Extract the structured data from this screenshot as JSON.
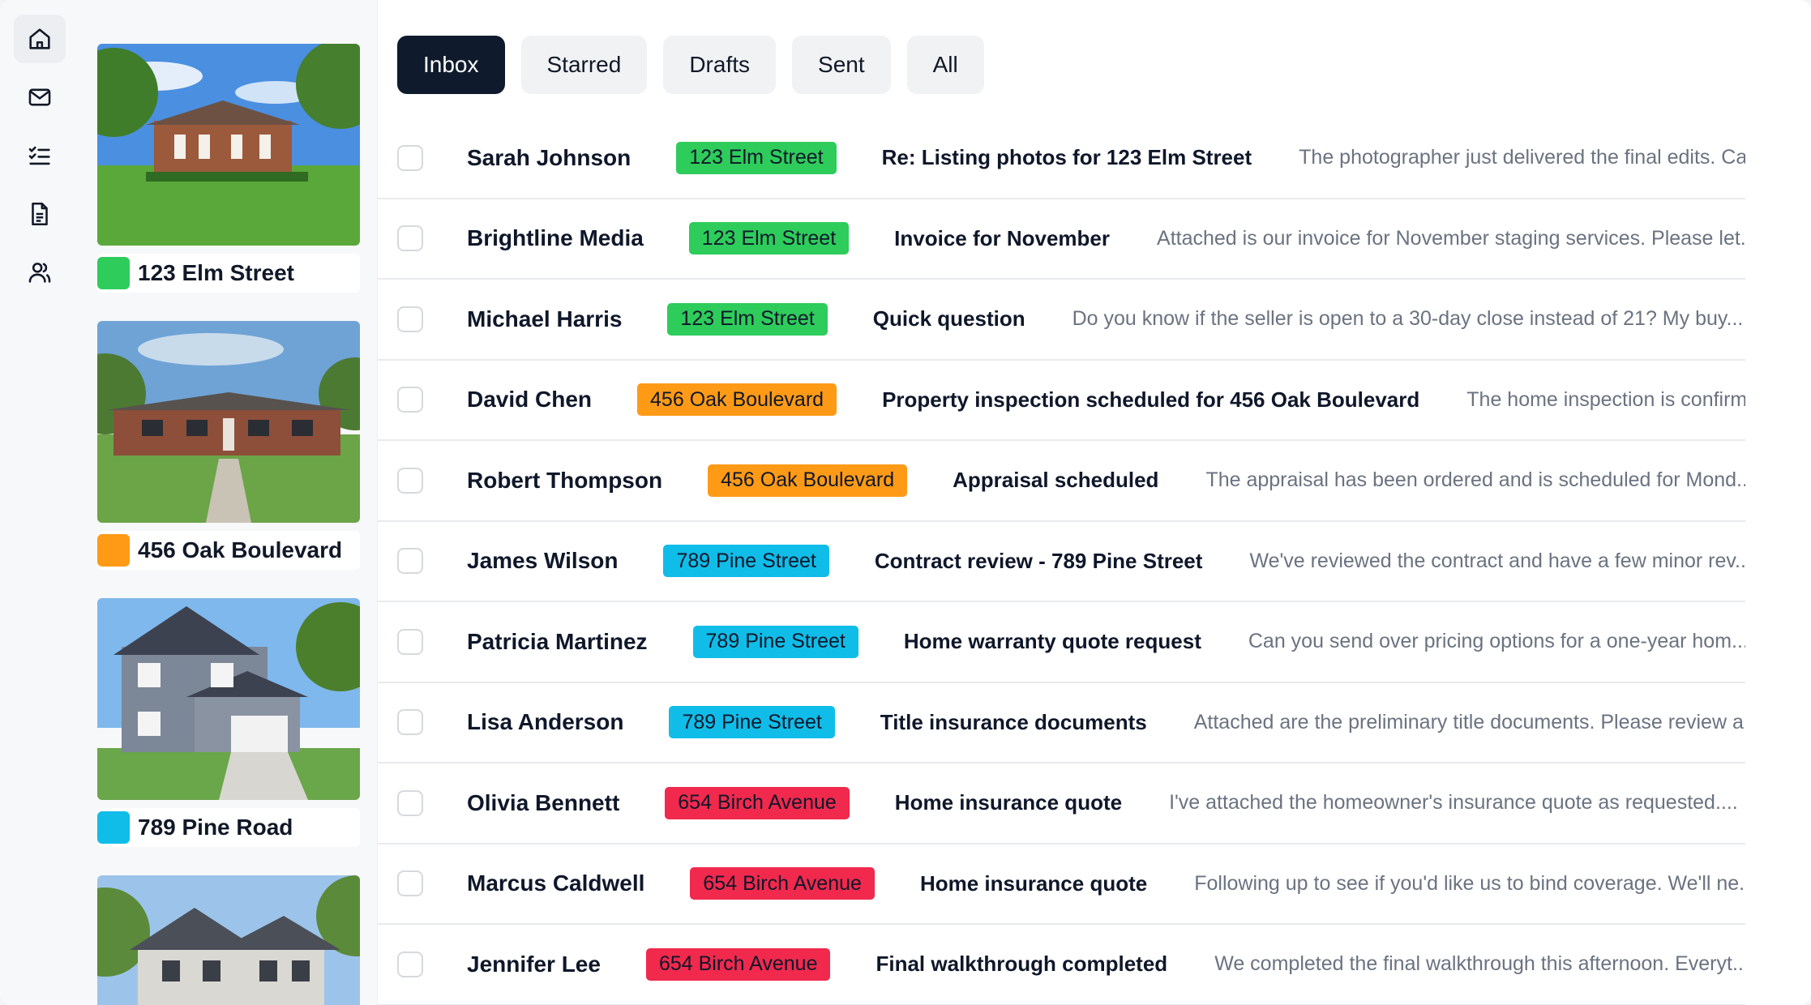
{
  "nav": {
    "icons": [
      "home-icon",
      "mail-icon",
      "checklist-icon",
      "document-icon",
      "users-icon"
    ],
    "active": "home-icon"
  },
  "properties": [
    {
      "name": "123 Elm Street",
      "color": "#2ecc5b"
    },
    {
      "name": "456 Oak Boulevard",
      "color": "#ff9a17"
    },
    {
      "name": "789 Pine Road",
      "color": "#10bde8"
    },
    {
      "name": "",
      "color": "#e8334f"
    }
  ],
  "tabs": [
    {
      "label": "Inbox",
      "active": true
    },
    {
      "label": "Starred",
      "active": false
    },
    {
      "label": "Drafts",
      "active": false
    },
    {
      "label": "Sent",
      "active": false
    },
    {
      "label": "All",
      "active": false
    }
  ],
  "messages": [
    {
      "sender": "Sarah Johnson",
      "tag": "123 Elm Street",
      "tag_color": "#2ecc5b",
      "subject": "Re: Listing photos for 123 Elm Street",
      "preview": "The photographer just delivered the final edits. Can..."
    },
    {
      "sender": "Brightline Media",
      "tag": "123 Elm Street",
      "tag_color": "#2ecc5b",
      "subject": "Invoice for November",
      "preview": "Attached is our invoice for November staging services. Please let..."
    },
    {
      "sender": "Michael Harris",
      "tag": "123 Elm Street",
      "tag_color": "#2ecc5b",
      "subject": "Quick question",
      "preview": "Do you know if the seller is open to a 30-day close instead of 21? My buy..."
    },
    {
      "sender": "David Chen",
      "tag": "456 Oak Boulevard",
      "tag_color": "#ff9a17",
      "subject": "Property inspection scheduled for 456 Oak Boulevard",
      "preview": "The home inspection is confirm..."
    },
    {
      "sender": "Robert Thompson",
      "tag": "456 Oak Boulevard",
      "tag_color": "#ff9a17",
      "subject": "Appraisal scheduled",
      "preview": "The appraisal has been ordered and is scheduled for Mond..."
    },
    {
      "sender": "James Wilson",
      "tag": "789 Pine Street",
      "tag_color": "#10bde8",
      "subject": "Contract review - 789 Pine Street",
      "preview": "We've reviewed the contract and have a few minor rev..."
    },
    {
      "sender": "Patricia Martinez",
      "tag": "789 Pine Street",
      "tag_color": "#10bde8",
      "subject": "Home warranty quote request",
      "preview": "Can you send over pricing options for a one-year hom..."
    },
    {
      "sender": "Lisa Anderson",
      "tag": "789 Pine Street",
      "tag_color": "#10bde8",
      "subject": "Title insurance documents",
      "preview": "Attached are the preliminary title documents. Please review a..."
    },
    {
      "sender": "Olivia Bennett",
      "tag": "654 Birch Avenue",
      "tag_color": "#f0294d",
      "subject": "Home insurance quote",
      "preview": "I've attached the homeowner's insurance quote as requested...."
    },
    {
      "sender": "Marcus Caldwell",
      "tag": "654 Birch Avenue",
      "tag_color": "#f0294d",
      "subject": "Home insurance quote",
      "preview": "Following up to see if you'd like us to bind coverage. We'll ne..."
    },
    {
      "sender": "Jennifer Lee",
      "tag": "654 Birch Avenue",
      "tag_color": "#f0294d",
      "subject": "Final walkthrough completed",
      "preview": "We completed the final walkthrough this afternoon. Everyt..."
    }
  ]
}
